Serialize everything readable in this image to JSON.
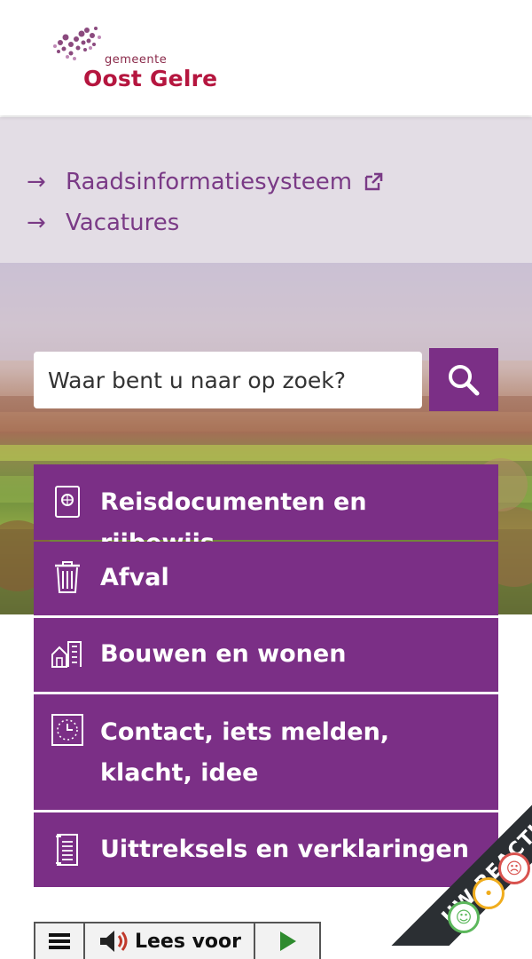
{
  "header": {
    "logo": {
      "small": "gemeente",
      "name": "Oost Gelre"
    }
  },
  "quicklinks": [
    {
      "label": "Raadsinformatiesysteem",
      "external": true
    },
    {
      "label": "Vacatures",
      "external": false
    }
  ],
  "search": {
    "placeholder": "Waar bent u naar op zoek?"
  },
  "tiles": [
    {
      "label": "Reisdocumenten en rijbewijs",
      "icon": "passport-icon"
    },
    {
      "label": "Afval",
      "icon": "trash-bin-icon"
    },
    {
      "label": "Bouwen en wonen",
      "icon": "buildings-icon"
    },
    {
      "label": "Contact, iets melden, klacht, idee",
      "icon": "clock-icon"
    },
    {
      "label": "Uittreksels en verklaringen",
      "icon": "document-icon"
    }
  ],
  "toolbar": {
    "read_label": "Lees voor"
  },
  "feedback": {
    "label": "UW REACTIE"
  },
  "colors": {
    "primary": "#7b2f86",
    "brand_red": "#b5163f",
    "quicklinks_bg": "#e3dde5"
  }
}
